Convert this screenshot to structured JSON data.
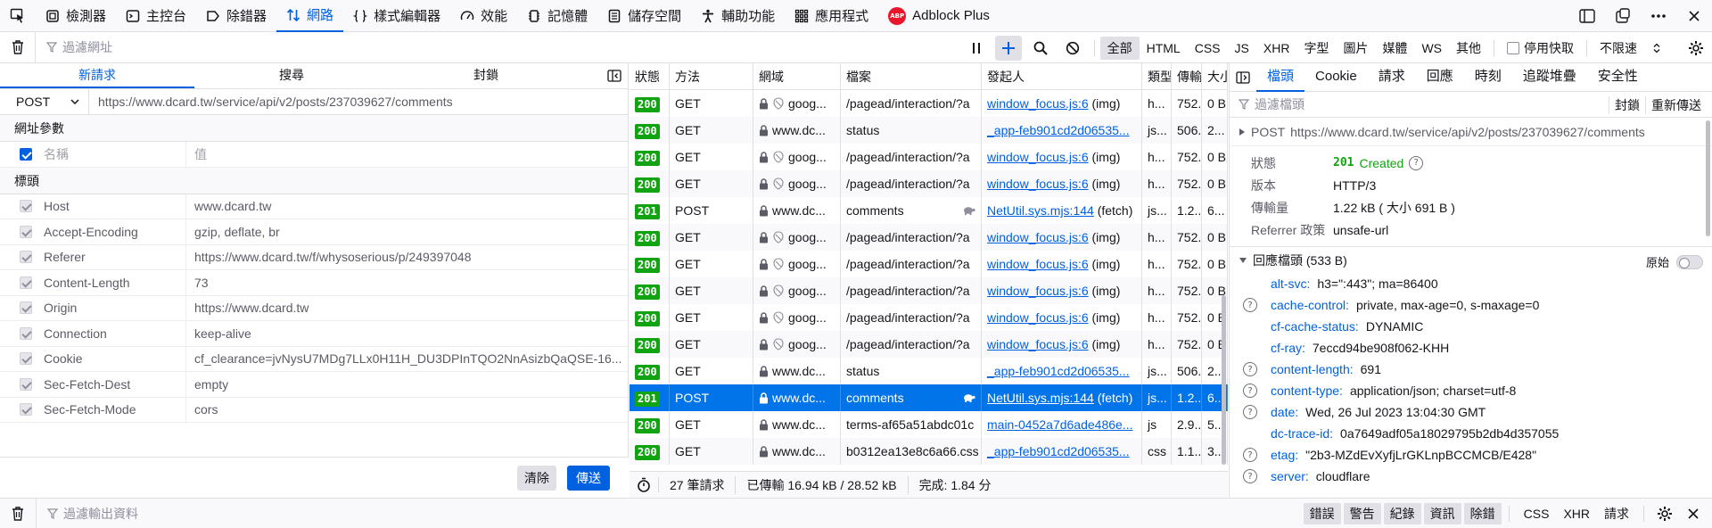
{
  "toolbar": {
    "tabs": [
      {
        "label": "檢測器",
        "icon": "inspector-icon"
      },
      {
        "label": "主控台",
        "icon": "console-icon"
      },
      {
        "label": "除錯器",
        "icon": "debugger-icon"
      },
      {
        "label": "網路",
        "icon": "network-icon"
      },
      {
        "label": "樣式編輯器",
        "icon": "style-editor-icon"
      },
      {
        "label": "效能",
        "icon": "performance-icon"
      },
      {
        "label": "記憶體",
        "icon": "memory-icon"
      },
      {
        "label": "儲存空間",
        "icon": "storage-icon"
      },
      {
        "label": "輔助功能",
        "icon": "accessibility-icon"
      },
      {
        "label": "應用程式",
        "icon": "application-icon"
      },
      {
        "label": "Adblock Plus",
        "icon": "adblock-icon",
        "badge": "ABP"
      }
    ],
    "active_tab": "網路"
  },
  "filterbar": {
    "placeholder": "過濾網址",
    "types": [
      "全部",
      "HTML",
      "CSS",
      "JS",
      "XHR",
      "字型",
      "圖片",
      "媒體",
      "WS",
      "其他"
    ],
    "selected_type": "全部",
    "disable_cache_label": "停用快取",
    "throttle_label": "不限速"
  },
  "left_panel": {
    "tabs": [
      "新請求",
      "搜尋",
      "封鎖"
    ],
    "method": "POST",
    "url": "https://www.dcard.tw/service/api/v2/posts/237039627/comments",
    "params_section": "網址參數",
    "param_placeholder": {
      "name": "名稱",
      "value": "值"
    },
    "headers_section": "標頭",
    "headers": [
      {
        "key": "Host",
        "value": "www.dcard.tw"
      },
      {
        "key": "Accept-Encoding",
        "value": "gzip, deflate, br"
      },
      {
        "key": "Referer",
        "value": "https://www.dcard.tw/f/whysoserious/p/249397048"
      },
      {
        "key": "Content-Length",
        "value": "73"
      },
      {
        "key": "Origin",
        "value": "https://www.dcard.tw"
      },
      {
        "key": "Connection",
        "value": "keep-alive"
      },
      {
        "key": "Cookie",
        "value": "cf_clearance=jvNysU7MDg7LLx0H11H_DU3DPInTQO2NnAsizbQaQSE-16..."
      },
      {
        "key": "Sec-Fetch-Dest",
        "value": "empty"
      },
      {
        "key": "Sec-Fetch-Mode",
        "value": "cors"
      }
    ],
    "clear_label": "清除",
    "send_label": "傳送"
  },
  "table": {
    "columns": [
      "狀態",
      "方法",
      "網域",
      "檔案",
      "發起人",
      "類型",
      "傳輸",
      "大小"
    ],
    "rows": [
      {
        "status": "200",
        "method": "GET",
        "domain": "goog...",
        "file": "/pagead/interaction/?a",
        "initiator": "window_focus.js:6",
        "init_suffix": " (img)",
        "type": "h...",
        "transfer": "752...",
        "size": "0 B",
        "tracker": true
      },
      {
        "status": "200",
        "method": "GET",
        "domain": "www.dc...",
        "file": "status",
        "initiator": "_app-feb901cd2d06535...",
        "init_suffix": "",
        "type": "js...",
        "transfer": "506...",
        "size": "2...",
        "tracker": false
      },
      {
        "status": "200",
        "method": "GET",
        "domain": "goog...",
        "file": "/pagead/interaction/?a",
        "initiator": "window_focus.js:6",
        "init_suffix": " (img)",
        "type": "h...",
        "transfer": "752...",
        "size": "0 B",
        "tracker": true
      },
      {
        "status": "200",
        "method": "GET",
        "domain": "goog...",
        "file": "/pagead/interaction/?a",
        "initiator": "window_focus.js:6",
        "init_suffix": " (img)",
        "type": "h...",
        "transfer": "752...",
        "size": "0 B",
        "tracker": true
      },
      {
        "status": "201",
        "method": "POST",
        "domain": "www.dc...",
        "file": "comments",
        "initiator": "NetUtil.sys.mjs:144",
        "init_suffix": " (fetch)",
        "type": "js...",
        "transfer": "1.2...",
        "size": "6...",
        "tracker": false,
        "turtle": true
      },
      {
        "status": "200",
        "method": "GET",
        "domain": "goog...",
        "file": "/pagead/interaction/?a",
        "initiator": "window_focus.js:6",
        "init_suffix": " (img)",
        "type": "h...",
        "transfer": "752...",
        "size": "0 B",
        "tracker": true
      },
      {
        "status": "200",
        "method": "GET",
        "domain": "goog...",
        "file": "/pagead/interaction/?a",
        "initiator": "window_focus.js:6",
        "init_suffix": " (img)",
        "type": "h...",
        "transfer": "752...",
        "size": "0 B",
        "tracker": true
      },
      {
        "status": "200",
        "method": "GET",
        "domain": "goog...",
        "file": "/pagead/interaction/?a",
        "initiator": "window_focus.js:6",
        "init_suffix": " (img)",
        "type": "h...",
        "transfer": "752...",
        "size": "0 B",
        "tracker": true
      },
      {
        "status": "200",
        "method": "GET",
        "domain": "goog...",
        "file": "/pagead/interaction/?a",
        "initiator": "window_focus.js:6",
        "init_suffix": " (img)",
        "type": "h...",
        "transfer": "752...",
        "size": "0 B",
        "tracker": true
      },
      {
        "status": "200",
        "method": "GET",
        "domain": "goog...",
        "file": "/pagead/interaction/?a",
        "initiator": "window_focus.js:6",
        "init_suffix": " (img)",
        "type": "h...",
        "transfer": "752...",
        "size": "0 B",
        "tracker": true
      },
      {
        "status": "200",
        "method": "GET",
        "domain": "www.dc...",
        "file": "status",
        "initiator": "_app-feb901cd2d06535...",
        "init_suffix": "",
        "type": "js...",
        "transfer": "506...",
        "size": "2...",
        "tracker": false
      },
      {
        "status": "201",
        "method": "POST",
        "domain": "www.dc...",
        "file": "comments",
        "initiator": "NetUtil.sys.mjs:144",
        "init_suffix": " (fetch)",
        "type": "js...",
        "transfer": "1.2...",
        "size": "6...",
        "tracker": false,
        "turtle": true,
        "selected": true
      },
      {
        "status": "200",
        "method": "GET",
        "domain": "www.dc...",
        "file": "terms-af65a51abdc01c",
        "initiator": "main-0452a7d6ade486e...",
        "init_suffix": "",
        "type": "js",
        "transfer": "2.9...",
        "size": "5...",
        "tracker": false
      },
      {
        "status": "200",
        "method": "GET",
        "domain": "www.dc...",
        "file": "b0312ea13e8c6a66.css",
        "initiator": "_app-feb901cd2d06535...",
        "init_suffix": "",
        "type": "css",
        "transfer": "1.1...",
        "size": "3...",
        "tracker": false
      }
    ],
    "status_bar": {
      "requests": "27 筆請求",
      "transferred": "已傳輸 16.94 kB / 28.52 kB",
      "finish": "完成: 1.84 分"
    }
  },
  "detail": {
    "tabs": [
      "檔頭",
      "Cookie",
      "請求",
      "回應",
      "時刻",
      "追蹤堆疊",
      "安全性"
    ],
    "active_tab": "檔頭",
    "filter_placeholder": "過濾檔頭",
    "block_label": "封鎖",
    "resend_label": "重新傳送",
    "summary_method": "POST",
    "summary_url": "https://www.dcard.tw/service/api/v2/posts/237039627/comments",
    "info": [
      {
        "key": "狀態",
        "value": "201 Created"
      },
      {
        "key": "版本",
        "value": "HTTP/3"
      },
      {
        "key": "傳輸量",
        "value": "1.22 kB ( 大小 691 B )"
      },
      {
        "key": "Referrer 政策",
        "value": "unsafe-url"
      }
    ],
    "status_code": "201",
    "status_text": "Created",
    "response_headers_title": "回應檔頭 (533 B)",
    "raw_label": "原始",
    "response_headers": [
      {
        "key": "alt-svc:",
        "value": "h3=\":443\"; ma=86400",
        "help": false
      },
      {
        "key": "cache-control:",
        "value": "private, max-age=0, s-maxage=0",
        "help": true
      },
      {
        "key": "cf-cache-status:",
        "value": "DYNAMIC",
        "help": false
      },
      {
        "key": "cf-ray:",
        "value": "7eccd94be908f062-KHH",
        "help": false
      },
      {
        "key": "content-length:",
        "value": "691",
        "help": true
      },
      {
        "key": "content-type:",
        "value": "application/json; charset=utf-8",
        "help": true
      },
      {
        "key": "date:",
        "value": "Wed, 26 Jul 2023 13:04:30 GMT",
        "help": true
      },
      {
        "key": "dc-trace-id:",
        "value": "0a7649adf05a18029795b2db4d357055",
        "help": false
      },
      {
        "key": "etag:",
        "value": "\"2b3-MZdEvXyfjLrGKLnpBCCMCB/E428\"",
        "help": true
      },
      {
        "key": "server:",
        "value": "cloudflare",
        "help": true
      }
    ]
  },
  "console": {
    "placeholder": "過濾輸出資料",
    "levels": [
      "錯誤",
      "警告",
      "紀錄",
      "資訊",
      "除錯"
    ],
    "extra": [
      "CSS",
      "XHR",
      "請求"
    ]
  },
  "colors": {
    "accent": "#0061e0",
    "status_ok": "#12a312",
    "selected_row": "#0074e8"
  }
}
